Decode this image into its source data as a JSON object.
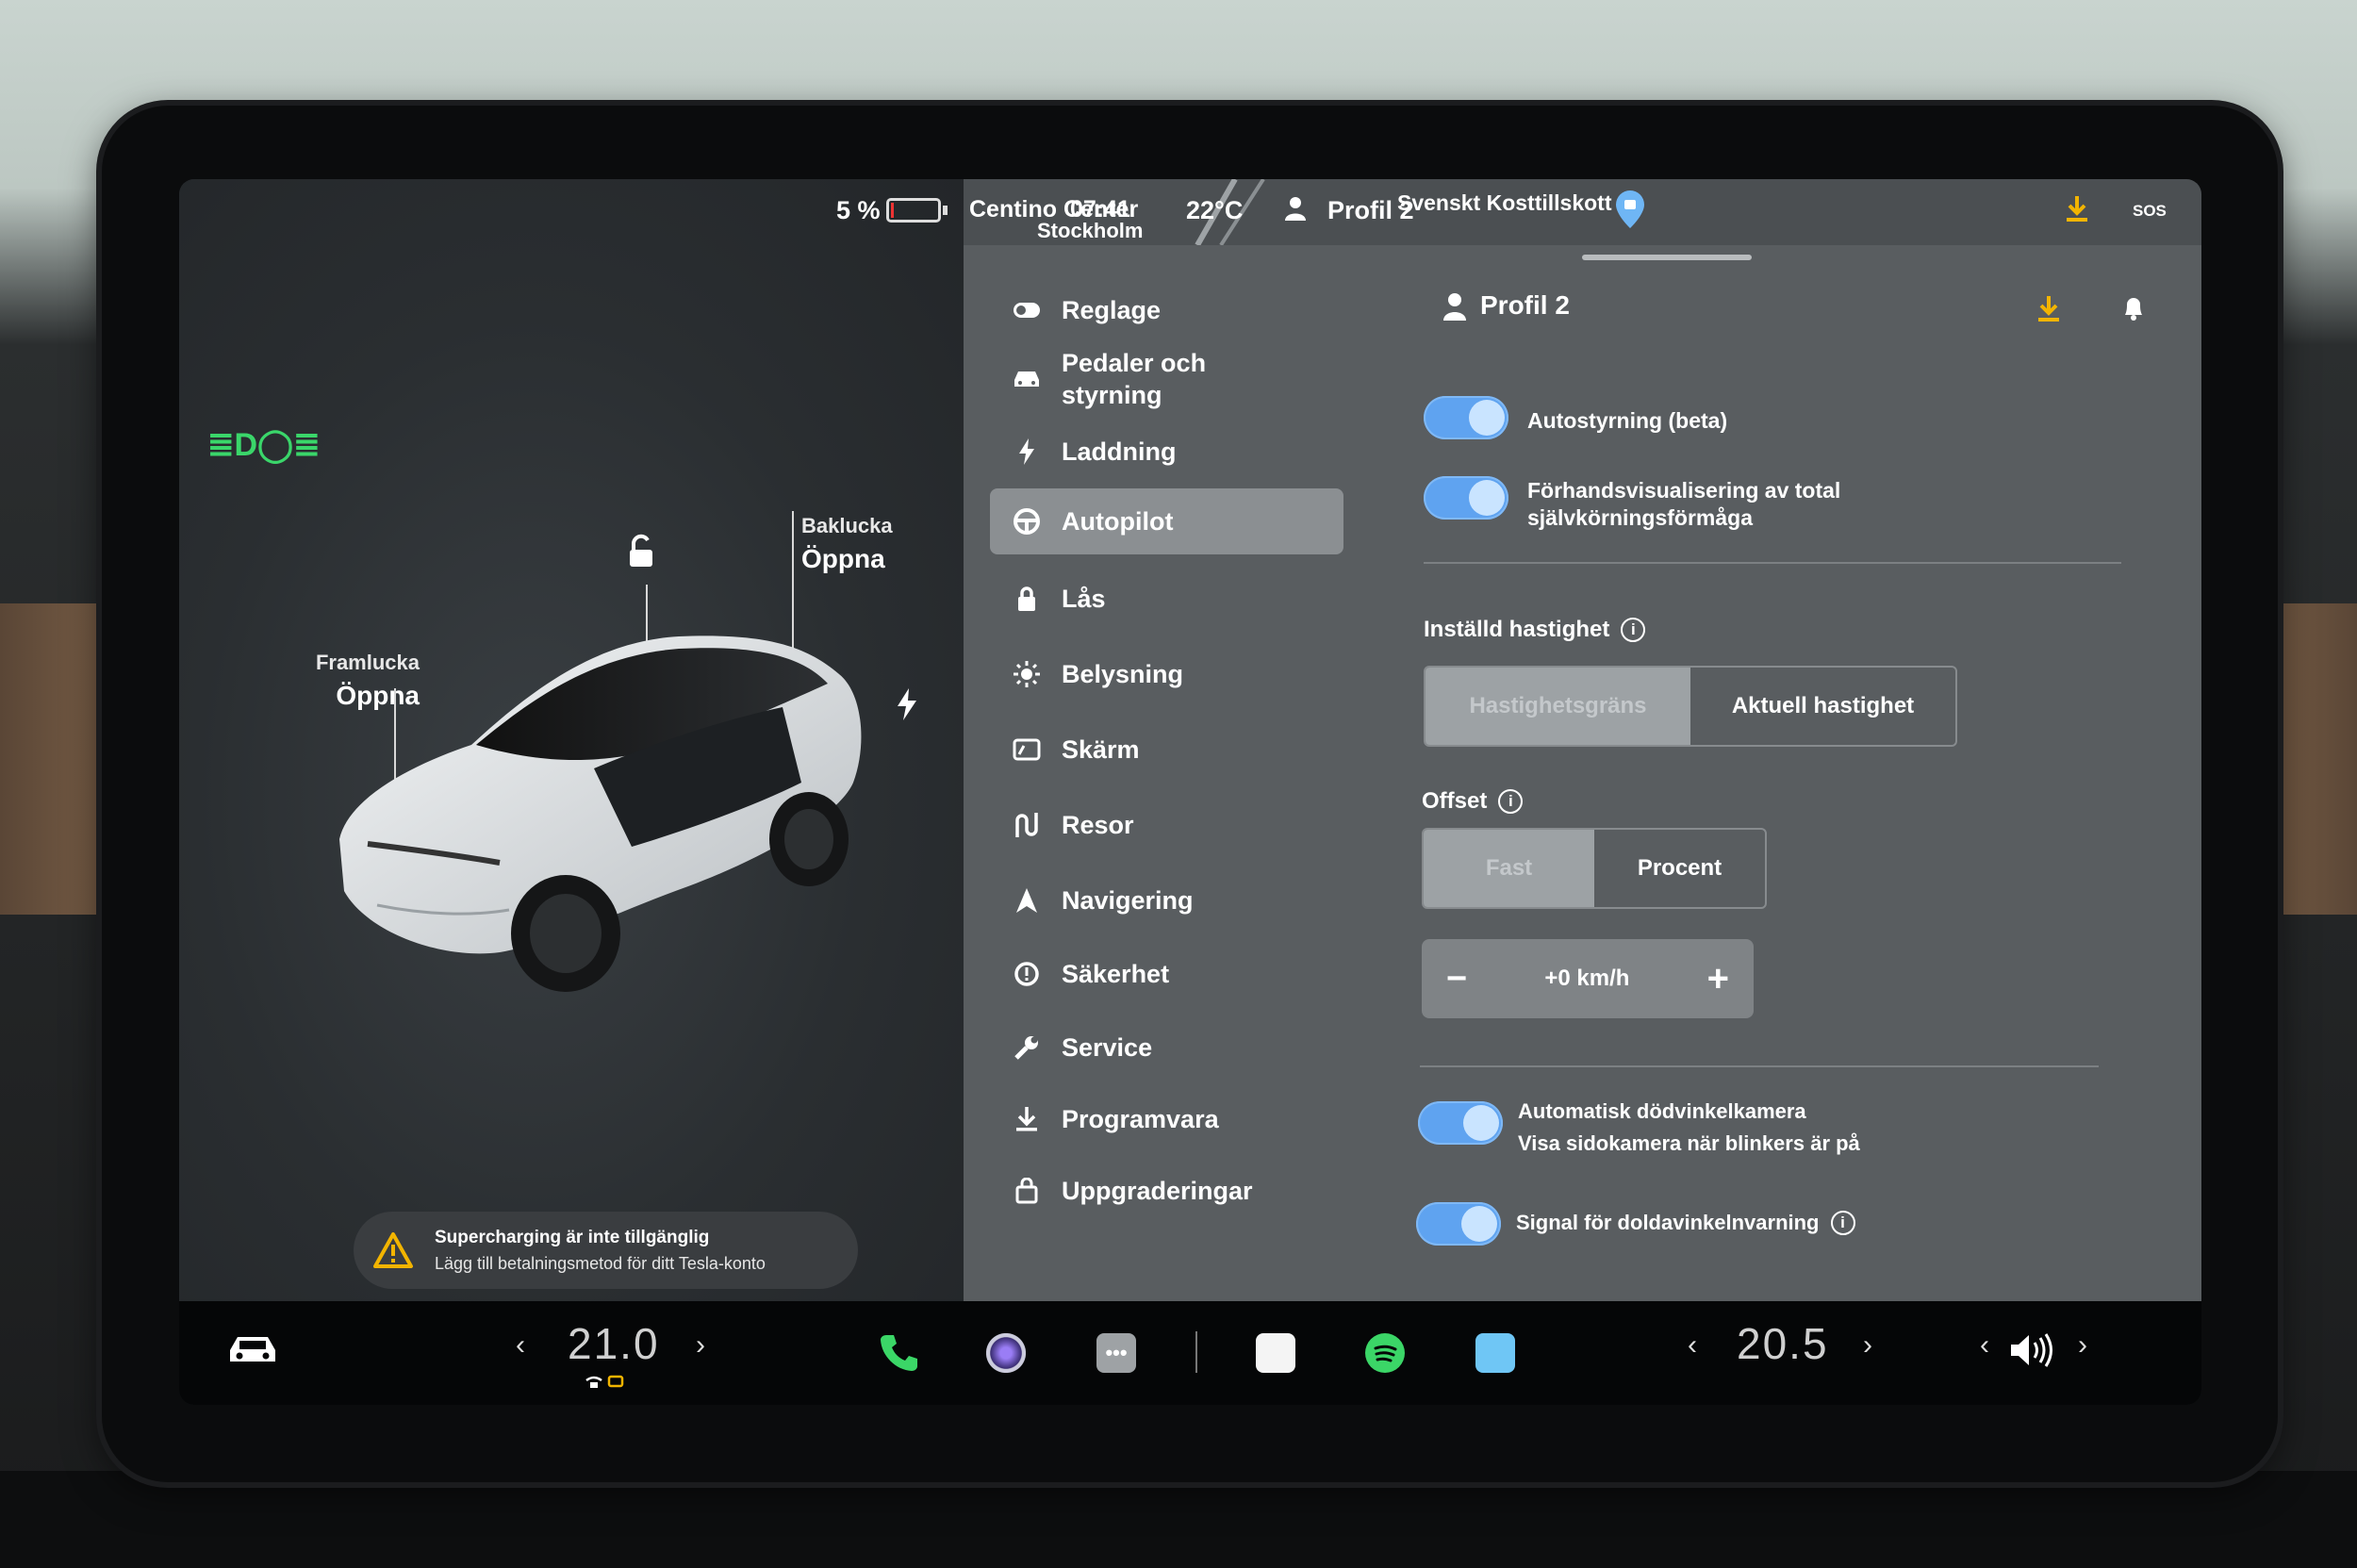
{
  "status": {
    "battery_percent": "5 %",
    "battery_level": 0.05,
    "location": "Centino Center",
    "location_sub": "Stockholm",
    "clock": "07:41",
    "temperature": "22°C",
    "profile": "Profil 2",
    "poi": "Svenskt Kosttillskott",
    "sos_label": "SOS"
  },
  "car": {
    "frunk_label": "Framlucka",
    "frunk_action": "Öppna",
    "trunk_label": "Baklucka",
    "trunk_action": "Öppna"
  },
  "alert": {
    "line1": "Supercharging är inte tillgänglig",
    "line2": "Lägg till betalningsmetod för ditt Tesla-konto"
  },
  "menu": [
    {
      "label": "Reglage",
      "icon": "toggle-icon"
    },
    {
      "label": "Pedaler och styrning",
      "icon": "car-icon"
    },
    {
      "label": "Laddning",
      "icon": "bolt-icon"
    },
    {
      "label": "Autopilot",
      "icon": "steering-wheel-icon",
      "active": true
    },
    {
      "label": "Lås",
      "icon": "lock-icon"
    },
    {
      "label": "Belysning",
      "icon": "sun-icon"
    },
    {
      "label": "Skärm",
      "icon": "display-icon"
    },
    {
      "label": "Resor",
      "icon": "trips-icon"
    },
    {
      "label": "Navigering",
      "icon": "navigation-icon"
    },
    {
      "label": "Säkerhet",
      "icon": "safety-icon"
    },
    {
      "label": "Service",
      "icon": "wrench-icon"
    },
    {
      "label": "Programvara",
      "icon": "download-icon"
    },
    {
      "label": "Uppgraderingar",
      "icon": "shopping-bag-icon"
    }
  ],
  "autopilot": {
    "profile_name": "Profil 2",
    "autosteer_label": "Autostyrning (beta)",
    "fsd_preview_line1": "Förhandsvisualisering av total",
    "fsd_preview_line2": "självkörningsförmåga",
    "set_speed_title": "Inställd hastighet",
    "set_speed_options": [
      "Hastighetsgräns",
      "Aktuell hastighet"
    ],
    "offset_title": "Offset",
    "offset_options": [
      "Fast",
      "Procent"
    ],
    "offset_value": "+0 km/h",
    "blindspot_cam_line1": "Automatisk dödvinkelkamera",
    "blindspot_cam_line2": "Visa sidokamera när blinkers är på",
    "blindspot_warning_label": "Signal för doldavinkelnvarning"
  },
  "taskbar": {
    "driver_temp": "21.0",
    "passenger_temp": "20.5"
  },
  "colors": {
    "toggle_on": "#5fa3f0",
    "accent_yellow": "#f2b400",
    "light_green": "#3ad66a"
  }
}
